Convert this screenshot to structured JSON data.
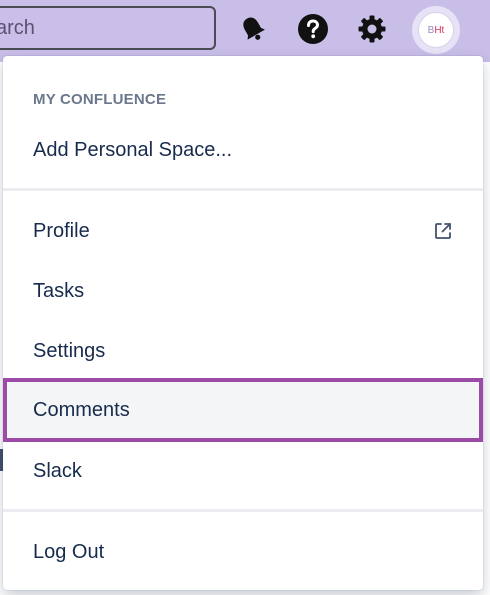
{
  "search": {
    "value": "arch"
  },
  "topbar": {
    "icons": {
      "notifications": "bell-icon",
      "help": "help-icon",
      "settings": "gear-icon"
    }
  },
  "avatar": {
    "initial_1": "B",
    "initial_2": "Ht"
  },
  "menu": {
    "heading": "MY CONFLUENCE",
    "add_personal_space": "Add Personal Space...",
    "items": [
      {
        "label": "Profile",
        "external": true
      },
      {
        "label": "Tasks"
      },
      {
        "label": "Settings"
      },
      {
        "label": "Comments",
        "highlighted": true
      },
      {
        "label": "Slack"
      }
    ],
    "logout": "Log Out"
  },
  "colors": {
    "topbar_bg": "#c9bee8",
    "highlight_border": "#9b4aa6",
    "highlight_bg": "#f4f5f7",
    "text": "#172b4d",
    "heading": "#6b778c"
  }
}
